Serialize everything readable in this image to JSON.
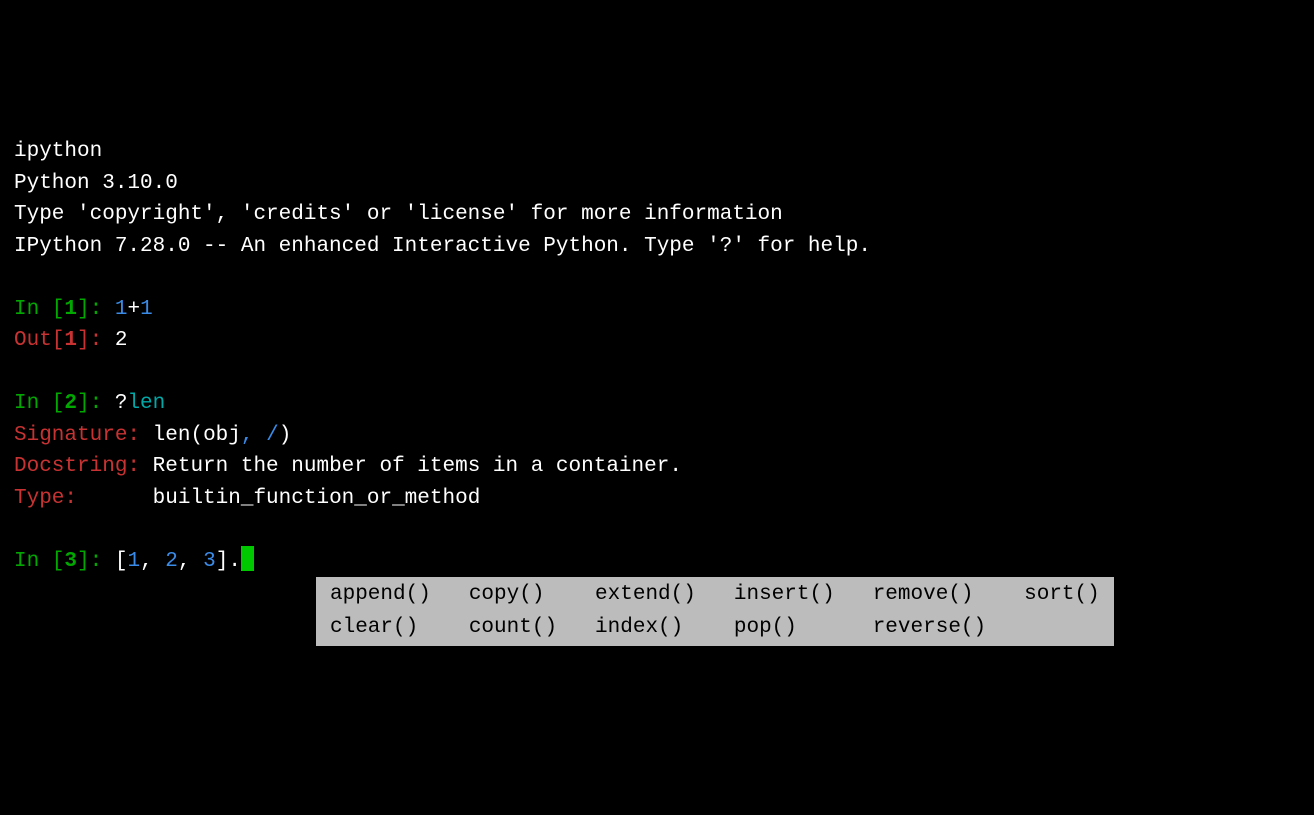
{
  "header": {
    "cmd": "ipython",
    "version": "Python 3.10.0",
    "copyright": "Type 'copyright', 'credits' or 'license' for more information",
    "ipython_info": "IPython 7.28.0 -- An enhanced Interactive Python. Type '?' for help."
  },
  "cell1": {
    "in_prefix": "In [",
    "in_num": "1",
    "in_suffix": "]: ",
    "input_a": "1",
    "input_plus": "+",
    "input_b": "1",
    "out_prefix": "Out[",
    "out_num": "1",
    "out_suffix": "]: ",
    "output": "2"
  },
  "cell2": {
    "in_prefix": "In [",
    "in_num": "2",
    "in_suffix": "]: ",
    "input_q": "?",
    "input_name": "len",
    "sig_label": "Signature:",
    "sig_pad": " ",
    "sig_fn": "len",
    "sig_p1": "(",
    "sig_arg": "obj",
    "sig_comma": ",",
    "sig_slash": " /",
    "sig_p2": ")",
    "doc_label": "Docstring:",
    "doc_pad": " ",
    "doc_text": "Return the number of items in a container.",
    "type_label": "Type:",
    "type_pad": "      ",
    "type_text": "builtin_function_or_method"
  },
  "cell3": {
    "in_prefix": "In [",
    "in_num": "3",
    "in_suffix": "]: ",
    "b1": "[",
    "n1": "1",
    "c1": ",",
    "s1": " ",
    "n2": "2",
    "c2": ",",
    "s2": " ",
    "n3": "3",
    "b2": "]",
    "dot": "."
  },
  "completions": {
    "r0c0": "append()",
    "r0c1": "copy()",
    "r0c2": "extend()",
    "r0c3": "insert()",
    "r0c4": "remove()",
    "r0c5": "sort()",
    "r1c0": "clear()",
    "r1c1": "count()",
    "r1c2": "index()",
    "r1c3": "pop()",
    "r1c4": "reverse()"
  }
}
